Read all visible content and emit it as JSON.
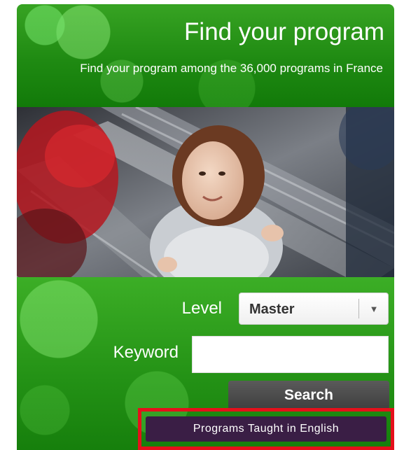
{
  "header": {
    "title": "Find your program",
    "subtitle": "Find your program among the 36,000 programs in France"
  },
  "photo": {
    "alt": "Photo of a smiling woman on an escalator"
  },
  "form": {
    "level_label": "Level",
    "level_value": "Master",
    "keyword_label": "Keyword",
    "keyword_value": "",
    "keyword_placeholder": "",
    "search_label": "Search"
  },
  "english_link": {
    "label": "Programs Taught in English"
  },
  "colors": {
    "brand_green": "#239115",
    "search_button": "#4a4a4a",
    "english_button": "#3a1e45",
    "highlight": "#e5101b"
  },
  "icons": {
    "dropdown": "chevron-down-icon"
  }
}
